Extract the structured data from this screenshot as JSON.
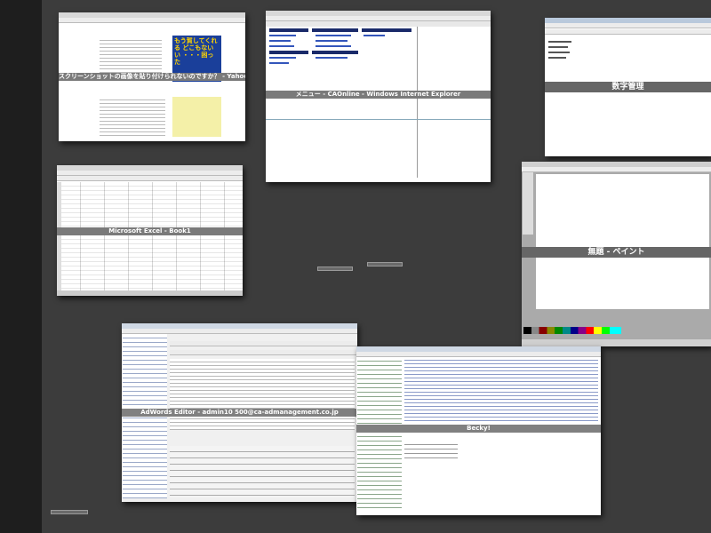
{
  "windows": {
    "chrome": {
      "title": "スクリーンショットの画像を貼り付けられないのですか？ - Yahoo!知恵袋 - Google Chrome",
      "banner": "もう賀してくれる どこもないい ・・・困った"
    },
    "ie": {
      "title": "メニュー - CAOnline - Windows Internet Explorer"
    },
    "suji": {
      "title": "数字管理"
    },
    "excel": {
      "title": "Microsoft Excel - Book1"
    },
    "paint": {
      "title": "無題 - ペイント"
    },
    "adwords": {
      "title": "AdWords Editor - admin10 500@ca-admanagement.co.jp"
    },
    "becky": {
      "title": "Becky!"
    }
  },
  "colors": {
    "desktop": "#3c3c3c",
    "caption": "#7a7a7a"
  }
}
